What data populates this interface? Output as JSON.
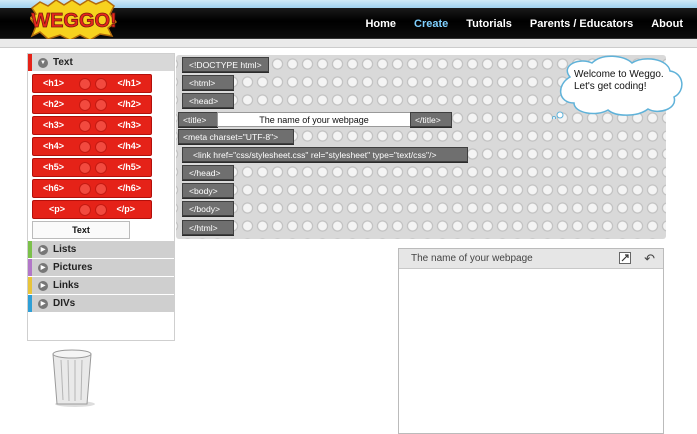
{
  "nav": {
    "logo": "WEGGO!",
    "items": [
      "Home",
      "Create",
      "Tutorials",
      "Parents / Educators",
      "About"
    ],
    "active": "Create"
  },
  "sidebar": {
    "text_section": "Text",
    "blocks": [
      {
        "open": "<h1>",
        "close": "</h1>"
      },
      {
        "open": "<h2>",
        "close": "</h2>"
      },
      {
        "open": "<h3>",
        "close": "</h3>"
      },
      {
        "open": "<h4>",
        "close": "</h4>"
      },
      {
        "open": "<h5>",
        "close": "</h5>"
      },
      {
        "open": "<h6>",
        "close": "</h6>"
      },
      {
        "open": "<p>",
        "close": "</p>"
      }
    ],
    "text_button": "Text",
    "sections": [
      "Lists",
      "Pictures",
      "Links",
      "DIVs"
    ],
    "section_colors": [
      "#7bc04a",
      "#b277c8",
      "#e8c43a",
      "#2e9fd6"
    ],
    "text_color": "#e52218"
  },
  "code": {
    "doctype": "<!DOCTYPE html>",
    "html_open": "<html>",
    "head_open": "<head>",
    "title_open": "<title>",
    "title_value": "The name of your webpage",
    "title_close": "</title>",
    "meta": "<meta charset=\"UTF-8\">",
    "link": "<link href=\"css/stylesheet.css\" rel=\"stylesheet\" type=\"text/css\"/>",
    "head_close": "</head>",
    "body_open": "<body>",
    "body_close": "</body>",
    "html_close": "</html>"
  },
  "bubble": {
    "line1": "Welcome to Weggo.",
    "line2": "Let's get coding!"
  },
  "preview": {
    "title": "The name of your webpage"
  }
}
